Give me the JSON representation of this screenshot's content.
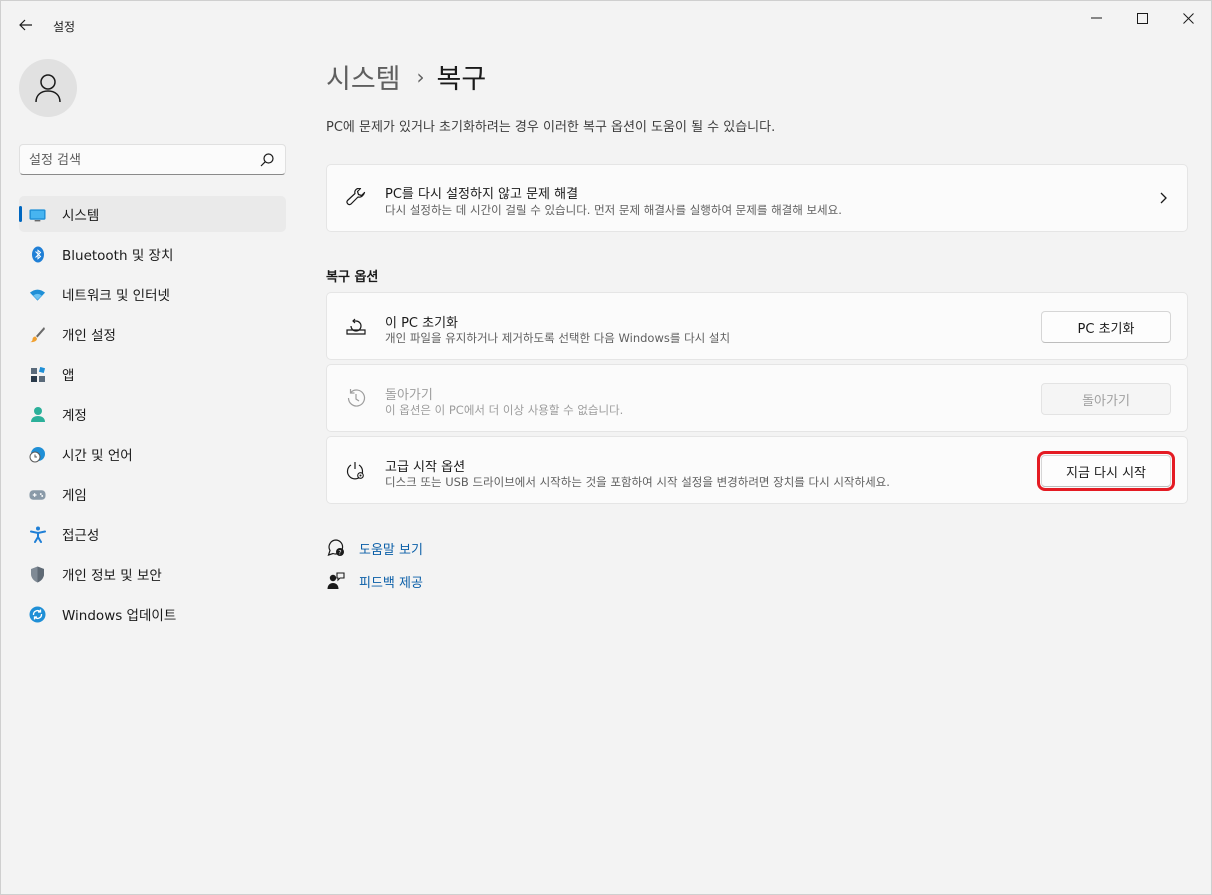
{
  "window": {
    "title": "설정"
  },
  "sidebar": {
    "search": {
      "placeholder": "설정 검색"
    },
    "items": [
      {
        "label": "시스템",
        "icon": "system-icon",
        "active": true
      },
      {
        "label": "Bluetooth 및 장치",
        "icon": "bluetooth-icon"
      },
      {
        "label": "네트워크 및 인터넷",
        "icon": "wifi-icon"
      },
      {
        "label": "개인 설정",
        "icon": "brush-icon"
      },
      {
        "label": "앱",
        "icon": "apps-icon"
      },
      {
        "label": "계정",
        "icon": "account-icon"
      },
      {
        "label": "시간 및 언어",
        "icon": "clock-globe-icon"
      },
      {
        "label": "게임",
        "icon": "gamepad-icon"
      },
      {
        "label": "접근성",
        "icon": "accessibility-icon"
      },
      {
        "label": "개인 정보 및 보안",
        "icon": "shield-icon"
      },
      {
        "label": "Windows 업데이트",
        "icon": "update-icon"
      }
    ]
  },
  "main": {
    "breadcrumb": {
      "parent": "시스템",
      "separator": "›",
      "current": "복구"
    },
    "description": "PC에 문제가 있거나 초기화하려는 경우 이러한 복구 옵션이 도움이 될 수 있습니다.",
    "troubleshoot_card": {
      "title": "PC를 다시 설정하지 않고 문제 해결",
      "subtitle": "다시 설정하는 데 시간이 걸릴 수 있습니다. 먼저 문제 해결사를 실행하여 문제를 해결해 보세요.",
      "icon": "wrench-icon"
    },
    "section_title": "복구 옵션",
    "options": [
      {
        "title": "이 PC 초기화",
        "subtitle": "개인 파일을 유지하거나 제거하도록 선택한 다음 Windows를 다시 설치",
        "button": "PC 초기화",
        "icon": "reset-pc-icon",
        "enabled": true
      },
      {
        "title": "돌아가기",
        "subtitle": "이 옵션은 이 PC에서 더 이상 사용할 수 없습니다.",
        "button": "돌아가기",
        "icon": "history-icon",
        "enabled": false
      },
      {
        "title": "고급 시작 옵션",
        "subtitle": "디스크 또는 USB 드라이브에서 시작하는 것을 포함하여 시작 설정을 변경하려면 장치를 다시 시작하세요.",
        "button": "지금 다시 시작",
        "icon": "advanced-startup-icon",
        "enabled": true,
        "highlighted": true
      }
    ],
    "links": [
      {
        "label": "도움말 보기",
        "icon": "help-icon"
      },
      {
        "label": "피드백 제공",
        "icon": "feedback-icon"
      }
    ]
  },
  "colors": {
    "accent": "#0067c0",
    "highlight_box": "#e41b23",
    "link": "#0b5fa8"
  }
}
